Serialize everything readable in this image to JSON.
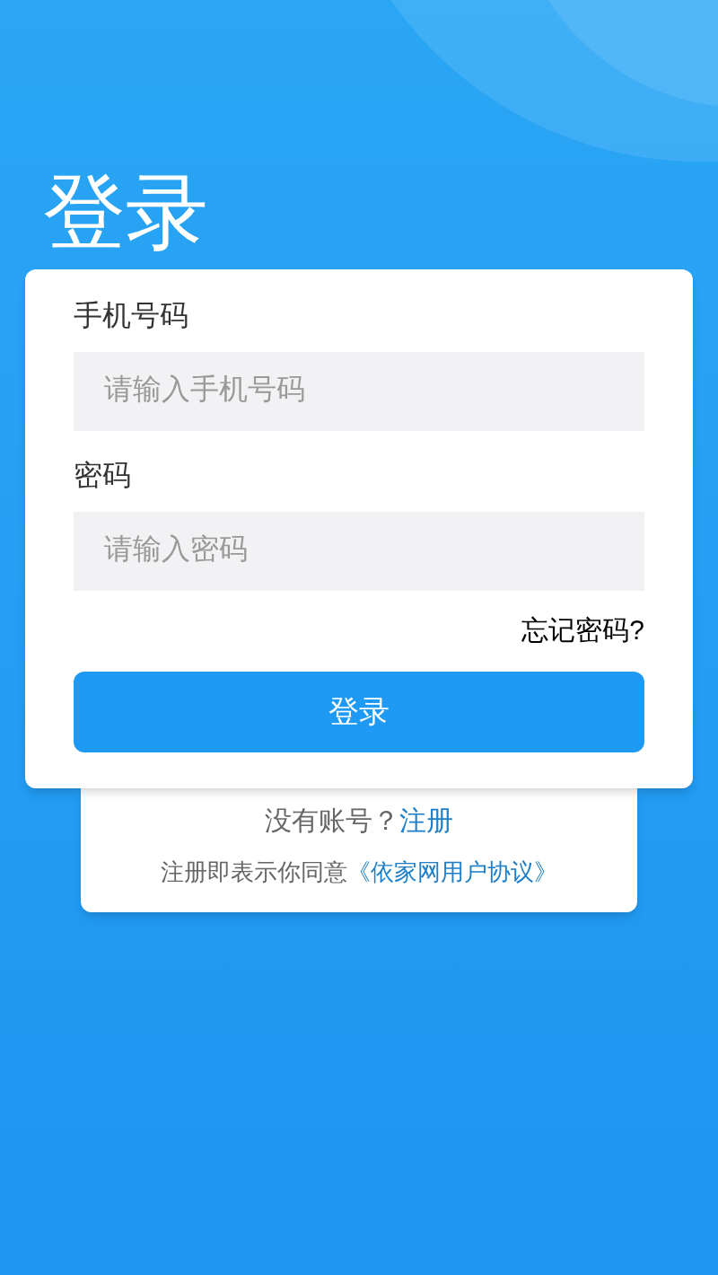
{
  "title": "登录",
  "form": {
    "phone_label": "手机号码",
    "phone_placeholder": "请输入手机号码",
    "password_label": "密码",
    "password_placeholder": "请输入密码",
    "forgot_link": "忘记密码?",
    "login_button": "登录"
  },
  "footer": {
    "register_prompt": "没有账号？",
    "register_link": "注册",
    "agreement_text": "注册即表示你同意",
    "agreement_link": "《依家网用户协议》"
  }
}
